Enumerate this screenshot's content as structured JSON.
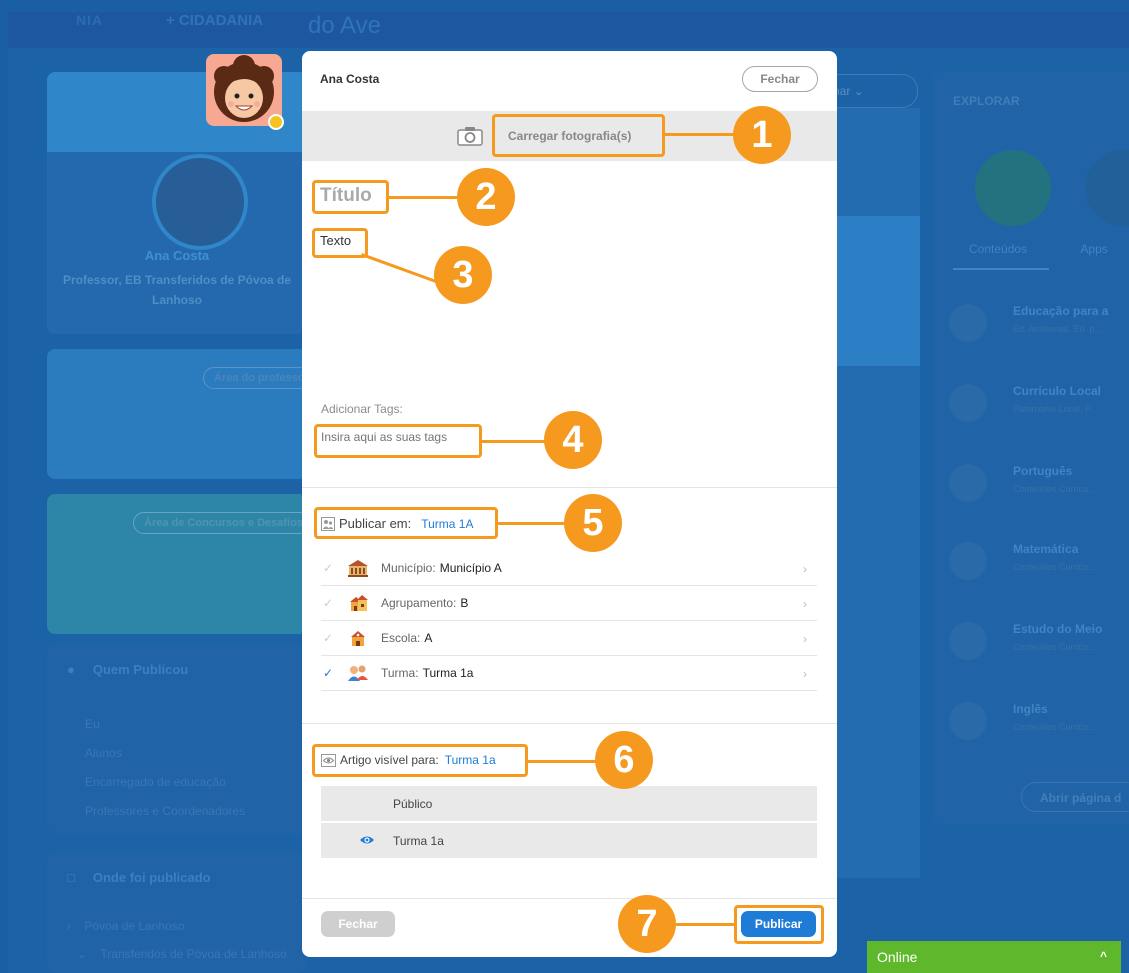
{
  "background": {
    "brand": "+ CIDADANIA",
    "brand_sub": "do Ave",
    "profile": {
      "name": "Ana Costa",
      "role": "Professor, EB Transferidos de Póvoa de Lanhoso"
    },
    "teacher_area_label": "Área do professor",
    "contest_area_label": "Área de Concursos e Desafios",
    "who_published": {
      "title": "Quem Publicou",
      "items": [
        "Eu",
        "Alunos",
        "Encarregado de educação",
        "Professores e Coordenadores"
      ]
    },
    "where_published": {
      "title": "Onde foi publicado",
      "items": [
        "Póvoa de Lanhoso",
        "Transferidos de Póvoa de Lanhoso"
      ]
    },
    "feed_filter_label": "nar",
    "explore": {
      "title": "EXPLORAR",
      "tabs": [
        "Conteúdos",
        "Apps"
      ],
      "items": [
        {
          "title": "Educação para a",
          "subtitle": "Ed. Ambiental, Ed. p..."
        },
        {
          "title": "Currículo Local",
          "subtitle": "Património Local, P..."
        },
        {
          "title": "Português",
          "subtitle": "Conteúdos Curricu..."
        },
        {
          "title": "Matemática",
          "subtitle": "Conteúdos Curricu..."
        },
        {
          "title": "Estudo do Meio",
          "subtitle": "Conteúdos Curricu..."
        },
        {
          "title": "Inglês",
          "subtitle": "Conteúdos Curricu..."
        }
      ],
      "open_page_label": "Abrir página d"
    }
  },
  "modal": {
    "author": "Ana Costa",
    "close_top": "Fechar",
    "upload_label": "Carregar fotografia(s)",
    "title_placeholder": "Título",
    "text_placeholder": "Texto",
    "tags_label": "Adicionar Tags:",
    "tags_placeholder": "Insira aqui as suas tags",
    "publish_in": {
      "label": "Publicar em:",
      "value": "Turma 1A"
    },
    "locations": [
      {
        "key": "Município:",
        "value": "Município A",
        "checked": false
      },
      {
        "key": "Agrupamento:",
        "value": "B",
        "checked": false
      },
      {
        "key": "Escola:",
        "value": "A",
        "checked": false
      },
      {
        "key": "Turma:",
        "value": "Turma 1a",
        "checked": true
      }
    ],
    "visible_to": {
      "label": "Artigo visível para:",
      "value": "Turma 1a",
      "options": [
        {
          "label": "Público",
          "selected": false
        },
        {
          "label": "Turma 1a",
          "selected": true
        }
      ]
    },
    "close_bottom": "Fechar",
    "publish": "Publicar"
  },
  "callouts": [
    "1",
    "2",
    "3",
    "4",
    "5",
    "6",
    "7"
  ],
  "online_bar": {
    "label": "Online"
  },
  "colors": {
    "accent": "#1e7bd6",
    "callout": "#f59a1f",
    "online": "#5fb82c",
    "overlay_bg": "#1c62a6",
    "status_dot": "#f4c320"
  }
}
